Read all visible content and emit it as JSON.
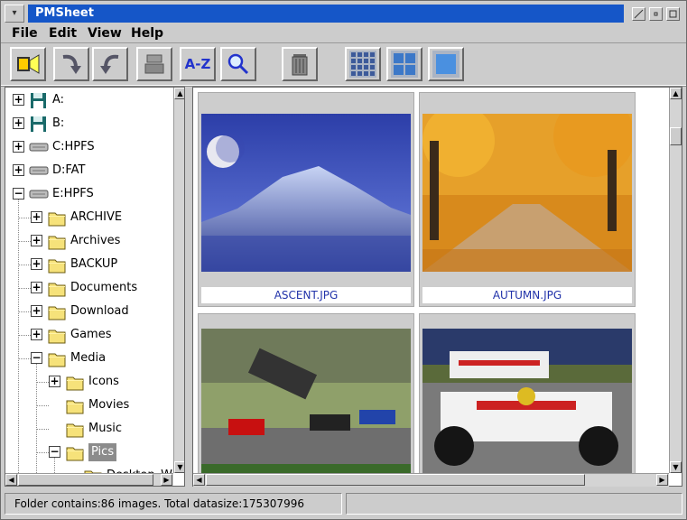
{
  "window": {
    "title": "PMSheet"
  },
  "menu": [
    "File",
    "Edit",
    "View",
    "Help"
  ],
  "toolbar": {
    "az_label": "A-Z"
  },
  "tree": {
    "items": [
      {
        "label": "A:",
        "type": "floppy",
        "state": "+"
      },
      {
        "label": "B:",
        "type": "floppy",
        "state": "+"
      },
      {
        "label": "C:HPFS",
        "type": "drive",
        "state": "+"
      },
      {
        "label": "D:FAT",
        "type": "drive",
        "state": "+"
      },
      {
        "label": "E:HPFS",
        "type": "drive",
        "state": "-"
      },
      {
        "label": "ARCHIVE",
        "type": "folder",
        "state": "+"
      },
      {
        "label": "Archives",
        "type": "folder",
        "state": "+"
      },
      {
        "label": "BACKUP",
        "type": "folder",
        "state": "+"
      },
      {
        "label": "Documents",
        "type": "folder",
        "state": "+"
      },
      {
        "label": "Download",
        "type": "folder",
        "state": "+"
      },
      {
        "label": "Games",
        "type": "folder",
        "state": "+"
      },
      {
        "label": "Media",
        "type": "folder",
        "state": "-"
      },
      {
        "label": "Icons",
        "type": "folder",
        "state": "+"
      },
      {
        "label": "Movies",
        "type": "folder",
        "state": ""
      },
      {
        "label": "Music",
        "type": "folder",
        "state": ""
      },
      {
        "label": "Pics",
        "type": "folder",
        "state": "-"
      },
      {
        "label": "Desktop_W",
        "type": "folder",
        "state": ""
      }
    ]
  },
  "images": [
    {
      "name": "ASCENT.JPG"
    },
    {
      "name": "AUTUMN.JPG"
    },
    {
      "name": ""
    },
    {
      "name": ""
    }
  ],
  "status": {
    "text": "Folder contains:86 images. Total datasize:175307996"
  },
  "colors": {
    "title_bar": "#1556c8",
    "caption_text": "#2233aa"
  }
}
